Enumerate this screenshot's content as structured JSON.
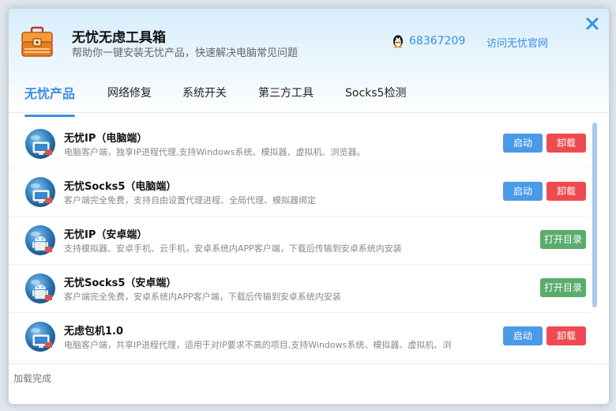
{
  "app": {
    "title": "无忧无虑工具箱",
    "subtitle": "帮助你一键安装无忧产品，快速解决电脑常见问题",
    "qq_number": "68367209",
    "visit_link": "访问无忧官网"
  },
  "tabs": [
    {
      "label": "无忧产品",
      "active": true
    },
    {
      "label": "网络修复"
    },
    {
      "label": "系统开关"
    },
    {
      "label": "第三方工具"
    },
    {
      "label": "Socks5检测"
    }
  ],
  "products": [
    {
      "title": "无忧IP（电脑端）",
      "desc": "电脑客户端，独享IP进程代理,支持Windows系统、模拟器、虚拟机、浏览器。",
      "icon": "pc-cloud-icon",
      "start_label": "启动",
      "uninstall_label": "卸载"
    },
    {
      "title": "无忧Socks5（电脑端）",
      "desc": "客户端完全免费，支持自由设置代理进程、全局代理、模拟器绑定",
      "icon": "pc-cloud-icon",
      "start_label": "启动",
      "uninstall_label": "卸载"
    },
    {
      "title": "无忧IP（安卓端）",
      "desc": "支持模拟器、安卓手机、云手机，安卓系统内APP客户端，下载后传输到安卓系统内安装",
      "icon": "android-cloud-icon",
      "open_label": "打开目录"
    },
    {
      "title": "无忧Socks5（安卓端）",
      "desc": "客户端完全免费，安卓系统内APP客户端，下载后传输到安卓系统内安装",
      "icon": "android-cloud-icon",
      "open_label": "打开目录"
    },
    {
      "title": "无虑包机1.0",
      "desc": "电脑客户端，共享IP进程代理，适用于对IP要求不高的项目,支持Windows系统、模拟器、虚拟机、浏",
      "icon": "pc-cloud-icon",
      "start_label": "启动",
      "uninstall_label": "卸载"
    }
  ],
  "status": "加载完成",
  "colors": {
    "accent": "#3a8ee6",
    "start": "#4a9ae8",
    "uninstall": "#ef4a4f",
    "open": "#5aac6c"
  }
}
